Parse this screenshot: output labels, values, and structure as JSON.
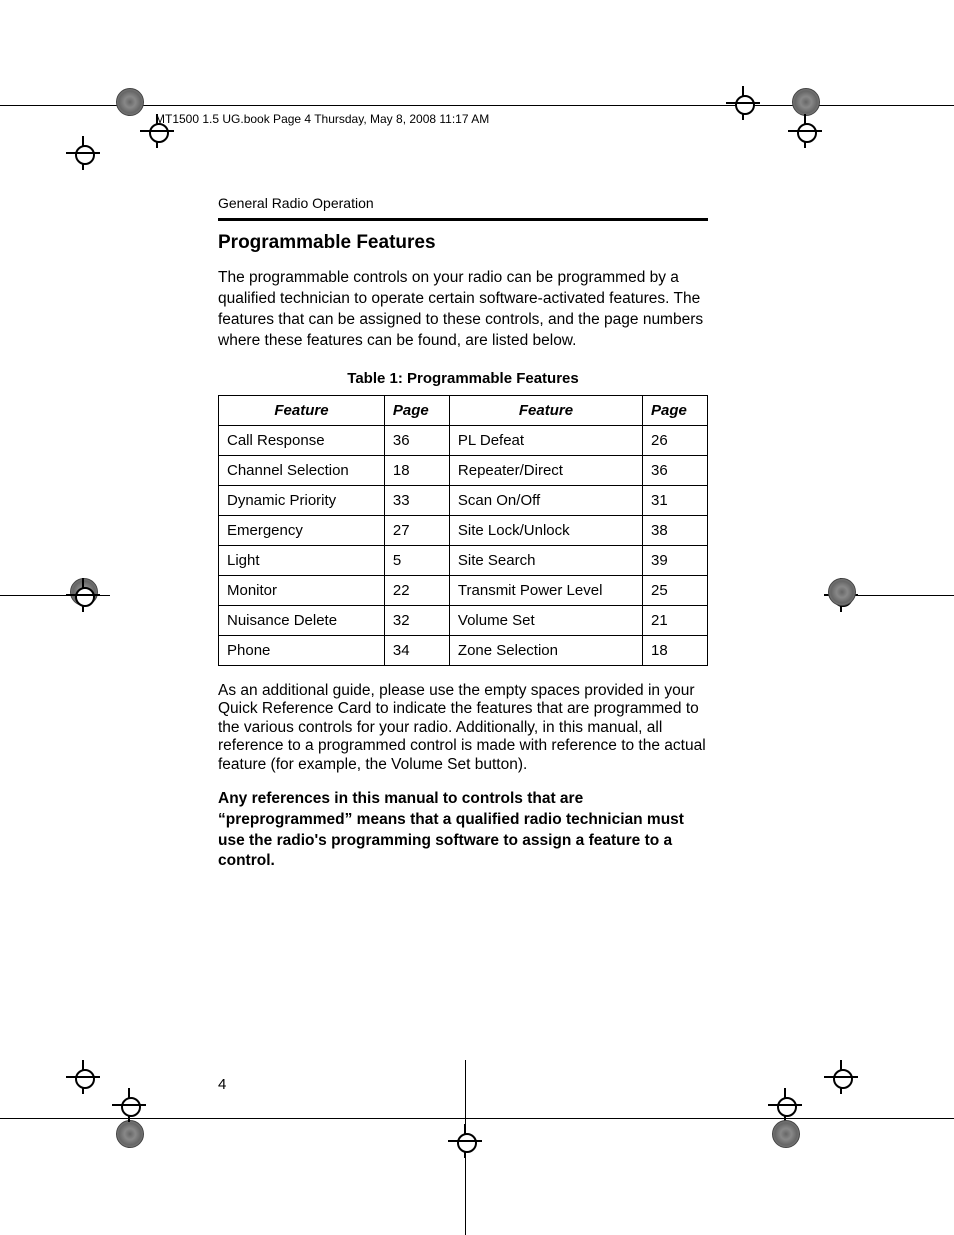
{
  "header_line": "MT1500 1.5 UG.book  Page 4  Thursday, May 8, 2008   11:17 AM",
  "section_header": "General Radio Operation",
  "title": "Programmable Features",
  "intro_para": "The programmable controls on your radio can be programmed by a qualified technician to operate certain software-activated features. The features that can be assigned to these controls, and the page numbers where these features can be found, are listed below.",
  "table_caption": "Table 1: Programmable Features",
  "table_headers": {
    "feature": "Feature",
    "page": "Page"
  },
  "table_rows": [
    {
      "f1": "Call Response",
      "p1": "36",
      "f2": "PL Defeat",
      "p2": "26"
    },
    {
      "f1": "Channel Selection",
      "p1": "18",
      "f2": "Repeater/Direct",
      "p2": "36"
    },
    {
      "f1": "Dynamic Priority",
      "p1": "33",
      "f2": "Scan On/Off",
      "p2": "31"
    },
    {
      "f1": "Emergency",
      "p1": "27",
      "f2": "Site Lock/Unlock",
      "p2": "38"
    },
    {
      "f1": "Light",
      "p1": "5",
      "f2": "Site Search",
      "p2": "39"
    },
    {
      "f1": "Monitor",
      "p1": "22",
      "f2": "Transmit Power Level",
      "p2": "25"
    },
    {
      "f1": "Nuisance Delete",
      "p1": "32",
      "f2": "Volume Set",
      "p2": "21"
    },
    {
      "f1": "Phone",
      "p1": "34",
      "f2": "Zone Selection",
      "p2": "18"
    }
  ],
  "guide_para": "As an additional guide, please use the empty spaces provided in your Quick Reference Card to indicate the features that are programmed to the various controls for your radio. Additionally, in this manual, all reference to a programmed control is made with reference to the actual feature (for example, the Volume Set button).",
  "bold_para": "Any references in this manual to controls that are “preprogrammed” means that a qualified radio technician must use the radio's programming software to assign a feature to a control.",
  "page_number": "4"
}
